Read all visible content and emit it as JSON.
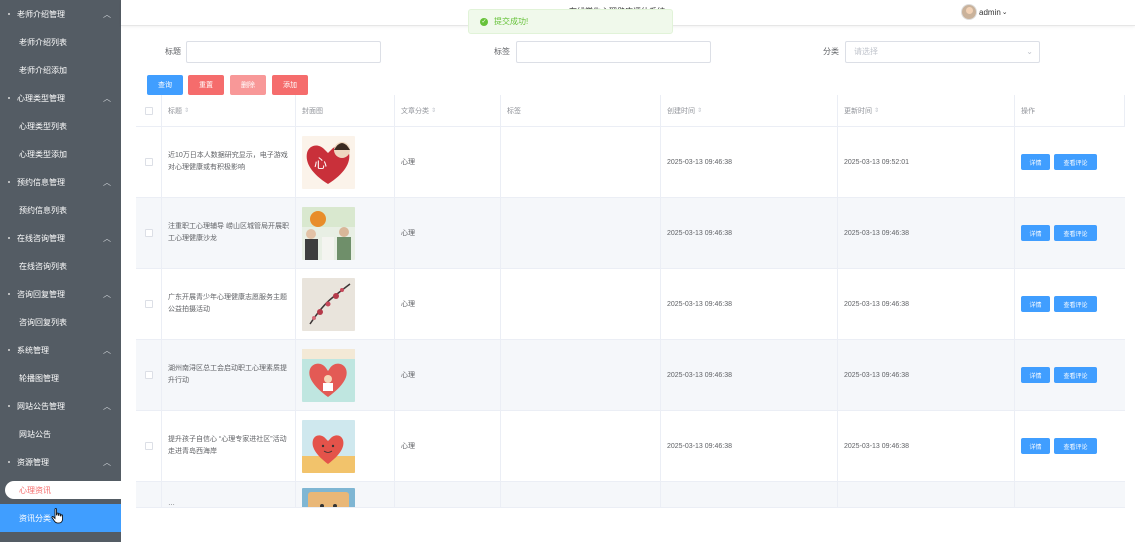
{
  "sidebar": {
    "groups": [
      {
        "label": "老师介绍管理",
        "items": [
          "老师介绍列表",
          "老师介绍添加"
        ]
      },
      {
        "label": "心理类型管理",
        "items": [
          "心理类型列表",
          "心理类型添加"
        ]
      },
      {
        "label": "预约信息管理",
        "items": [
          "预约信息列表"
        ]
      },
      {
        "label": "在线咨询管理",
        "items": [
          "在线咨询列表"
        ]
      },
      {
        "label": "咨询回复管理",
        "items": [
          "咨询回复列表"
        ]
      },
      {
        "label": "系统管理",
        "items": [
          "轮播图管理"
        ]
      },
      {
        "label": "网站公告管理",
        "items": [
          "网站公告"
        ]
      },
      {
        "label": "资源管理",
        "items": [
          "心理资讯",
          "资讯分类"
        ]
      }
    ]
  },
  "header": {
    "title": "…在线学生心理健康评估系统",
    "user": "admin"
  },
  "toast": {
    "message": "提交成功!"
  },
  "search": {
    "title_label": "标题",
    "tag_label": "标签",
    "category_label": "分类",
    "category_placeholder": "请选择"
  },
  "buttons": {
    "query": "查询",
    "reset": "重置",
    "delete": "删除",
    "add": "添加"
  },
  "table": {
    "headers": {
      "title": "标题",
      "cover": "封面图",
      "category": "文章分类",
      "tag": "标签",
      "created": "创建时间",
      "updated": "更新时间",
      "actions": "操作"
    },
    "detail_label": "详情",
    "comment_label": "查看评论",
    "rows": [
      {
        "title": "近10万日本人数据研究显示，电子游戏对心理健康或有积极影响",
        "category": "心理",
        "tag": "",
        "created": "2025-03-13 09:46:38",
        "updated": "2025-03-13 09:52:01"
      },
      {
        "title": "注重职工心理辅导 崂山区城管局开展职工心理健康沙龙",
        "category": "心理",
        "tag": "",
        "created": "2025-03-13 09:46:38",
        "updated": "2025-03-13 09:46:38"
      },
      {
        "title": "广东开展青少年心理健康志愿服务主题公益拍摄活动",
        "category": "心理",
        "tag": "",
        "created": "2025-03-13 09:46:38",
        "updated": "2025-03-13 09:46:38"
      },
      {
        "title": "湖州南浔区总工会启动职工心理素质提升行动",
        "category": "心理",
        "tag": "",
        "created": "2025-03-13 09:46:38",
        "updated": "2025-03-13 09:46:38"
      },
      {
        "title": "提升孩子自信心 “心理专家进社区”活动走进青岛西海岸",
        "category": "心理",
        "tag": "",
        "created": "2025-03-13 09:46:38",
        "updated": "2025-03-13 09:46:38"
      },
      {
        "title": "…",
        "category": "",
        "tag": "",
        "created": "",
        "updated": ""
      }
    ]
  }
}
